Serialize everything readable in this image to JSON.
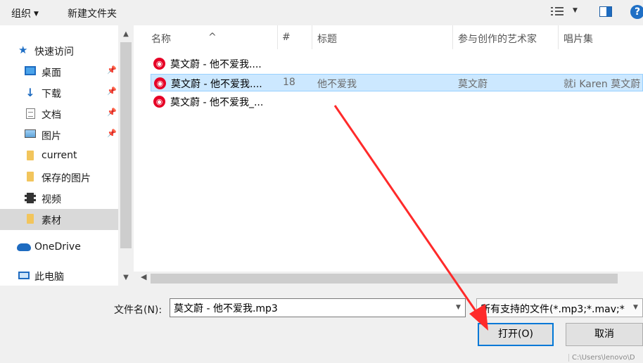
{
  "toolbar": {
    "organize": "组织",
    "new_folder": "新建文件夹",
    "help": "?"
  },
  "nav": {
    "items": [
      {
        "label": "快速访问",
        "icon": "star-icon"
      },
      {
        "label": "桌面",
        "icon": "desktop-icon",
        "pinned": true
      },
      {
        "label": "下载",
        "icon": "download-icon",
        "pinned": true
      },
      {
        "label": "文档",
        "icon": "document-icon",
        "pinned": true
      },
      {
        "label": "图片",
        "icon": "pictures-icon",
        "pinned": true
      },
      {
        "label": "current",
        "icon": "folder-icon"
      },
      {
        "label": "保存的图片",
        "icon": "folder-icon"
      },
      {
        "label": "视频",
        "icon": "video-icon"
      },
      {
        "label": "素材",
        "icon": "folder-icon",
        "selected": true
      },
      {
        "label": "OneDrive",
        "icon": "onedrive-icon"
      },
      {
        "label": "此电脑",
        "icon": "pc-icon"
      }
    ]
  },
  "list": {
    "columns": [
      "名称",
      "#",
      "标题",
      "参与创作的艺术家",
      "唱片集"
    ],
    "rows": [
      {
        "name": "莫文蔚 - 他不爱我....",
        "num": "",
        "title": "",
        "artist": "",
        "album": ""
      },
      {
        "name": "莫文蔚 - 他不爱我....",
        "num": "18",
        "title": "他不爱我",
        "artist": "莫文蔚",
        "album": "就i Karen 莫文蔚"
      },
      {
        "name": "莫文蔚 - 他不爱我_...",
        "num": "",
        "title": "",
        "artist": "",
        "album": ""
      }
    ]
  },
  "bottom": {
    "filename_label": "文件名(N):",
    "filename_value": "莫文蔚 - 他不爱我.mp3",
    "filter_value": "所有支持的文件(*.mp3;*.mav;*",
    "open_label": "打开(O)",
    "cancel_label": "取消",
    "status_path": "C:\\Users\\lenovo\\D"
  },
  "colors": {
    "accent": "#0078d7",
    "selection": "#cce8ff",
    "file_icon": "#e60026",
    "annotation_arrow": "#ff2a2a"
  }
}
